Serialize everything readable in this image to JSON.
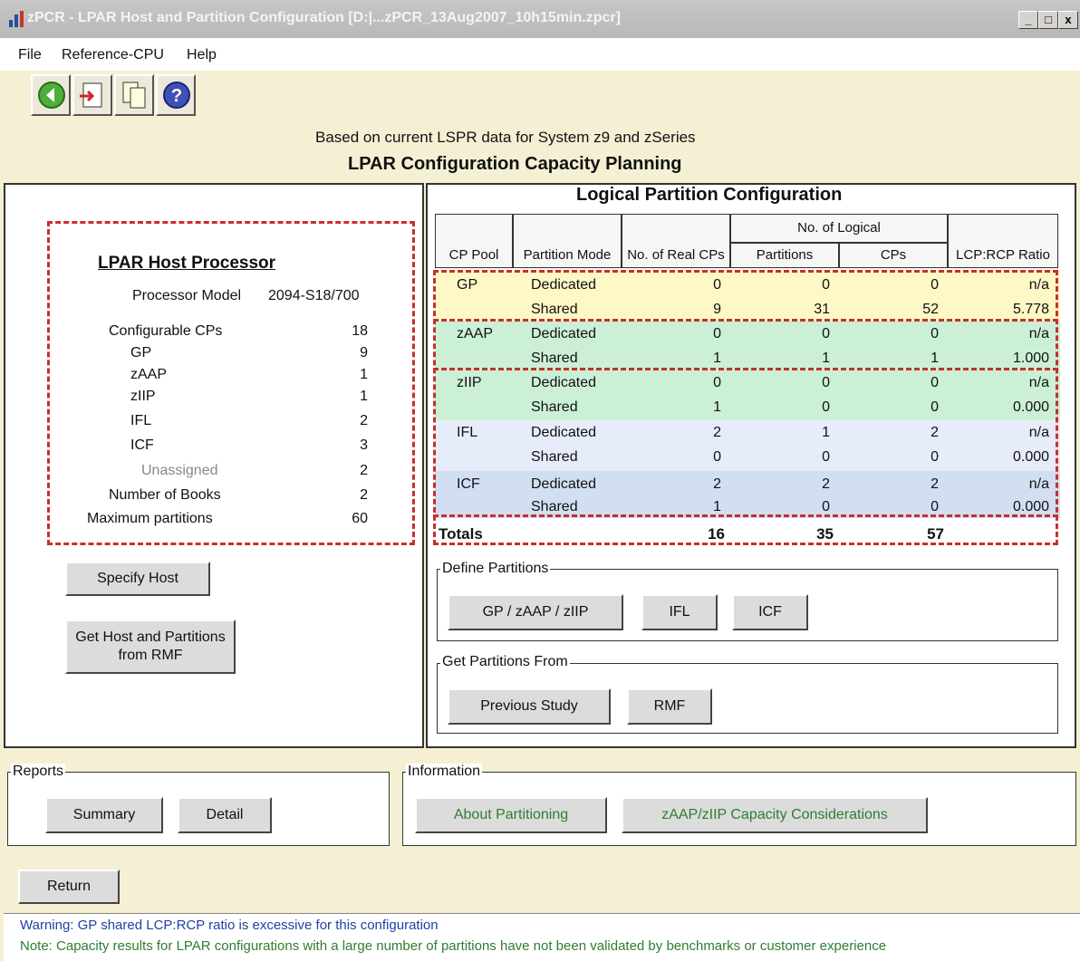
{
  "window": {
    "title": "zPCR - LPAR Host and Partition Configuration [D:|...zPCR_13Aug2007_10h15min.zpcr]",
    "controls": [
      "_",
      "□",
      "x"
    ]
  },
  "menu": [
    "File",
    "Reference-CPU",
    "Help"
  ],
  "toolbar": [
    "back-icon",
    "export-icon",
    "copy-icon",
    "help-icon"
  ],
  "header": {
    "subtitle": "Based on current LSPR data for System z9 and zSeries",
    "title": "LPAR Configuration Capacity Planning"
  },
  "host": {
    "title": "LPAR Host Processor",
    "model_label": "Processor Model",
    "model_value": "2094-S18/700",
    "rows": [
      {
        "label": "Configurable CPs",
        "value": "18"
      },
      {
        "label": "GP",
        "value": "9"
      },
      {
        "label": "zAAP",
        "value": "1"
      },
      {
        "label": "zIIP",
        "value": "1"
      },
      {
        "label": "IFL",
        "value": "2"
      },
      {
        "label": "ICF",
        "value": "3"
      },
      {
        "label": "Unassigned",
        "value": "2"
      },
      {
        "label": "Number of Books",
        "value": "2"
      },
      {
        "label": "Maximum partitions",
        "value": "60"
      }
    ],
    "specify_host": "Specify Host",
    "get_host_rmf": "Get Host and Partitions from RMF"
  },
  "partition": {
    "title": "Logical Partition Configuration",
    "headers": {
      "cp_pool": "CP Pool",
      "mode": "Partition Mode",
      "real_cps": "No. of Real CPs",
      "no_logical": "No. of Logical",
      "partitions": "Partitions",
      "cps": "CPs",
      "ratio": "LCP:RCP Ratio"
    },
    "rows": [
      {
        "pool": "GP",
        "mode": "Dedicated",
        "real": "0",
        "parts": "0",
        "cps": "0",
        "ratio": "n/a"
      },
      {
        "pool": "",
        "mode": "Shared",
        "real": "9",
        "parts": "31",
        "cps": "52",
        "ratio": "5.778"
      },
      {
        "pool": "zAAP",
        "mode": "Dedicated",
        "real": "0",
        "parts": "0",
        "cps": "0",
        "ratio": "n/a"
      },
      {
        "pool": "",
        "mode": "Shared",
        "real": "1",
        "parts": "1",
        "cps": "1",
        "ratio": "1.000"
      },
      {
        "pool": "zIIP",
        "mode": "Dedicated",
        "real": "0",
        "parts": "0",
        "cps": "0",
        "ratio": "n/a"
      },
      {
        "pool": "",
        "mode": "Shared",
        "real": "1",
        "parts": "0",
        "cps": "0",
        "ratio": "0.000"
      },
      {
        "pool": "IFL",
        "mode": "Dedicated",
        "real": "2",
        "parts": "1",
        "cps": "2",
        "ratio": "n/a"
      },
      {
        "pool": "",
        "mode": "Shared",
        "real": "0",
        "parts": "0",
        "cps": "0",
        "ratio": "0.000"
      },
      {
        "pool": "ICF",
        "mode": "Dedicated",
        "real": "2",
        "parts": "2",
        "cps": "2",
        "ratio": "n/a"
      },
      {
        "pool": "",
        "mode": "Shared",
        "real": "1",
        "parts": "0",
        "cps": "0",
        "ratio": "0.000"
      }
    ],
    "totals": {
      "label": "Totals",
      "real": "16",
      "parts": "35",
      "cps": "57"
    },
    "row_colors": {
      "gp": "#fdf8c6",
      "zaap": "#ccf0d6",
      "ziip": "#ccf0d6",
      "ifl": "#e6ecfa",
      "icf": "#d2def2"
    }
  },
  "define": {
    "label": "Define Partitions",
    "buttons": [
      "GP / zAAP / zIIP",
      "IFL",
      "ICF"
    ]
  },
  "get_from": {
    "label": "Get Partitions From",
    "buttons": [
      "Previous Study",
      "RMF"
    ]
  },
  "reports": {
    "label": "Reports",
    "buttons": [
      "Summary",
      "Detail"
    ]
  },
  "information": {
    "label": "Information",
    "buttons": [
      "About Partitioning",
      "zAAP/zIIP Capacity Considerations"
    ]
  },
  "return_label": "Return",
  "messages": {
    "warning": "Warning: GP shared LCP:RCP ratio is excessive for this configuration",
    "note": "Note: Capacity results for LPAR configurations with a large number of partitions have not been validated by benchmarks or customer experience"
  }
}
